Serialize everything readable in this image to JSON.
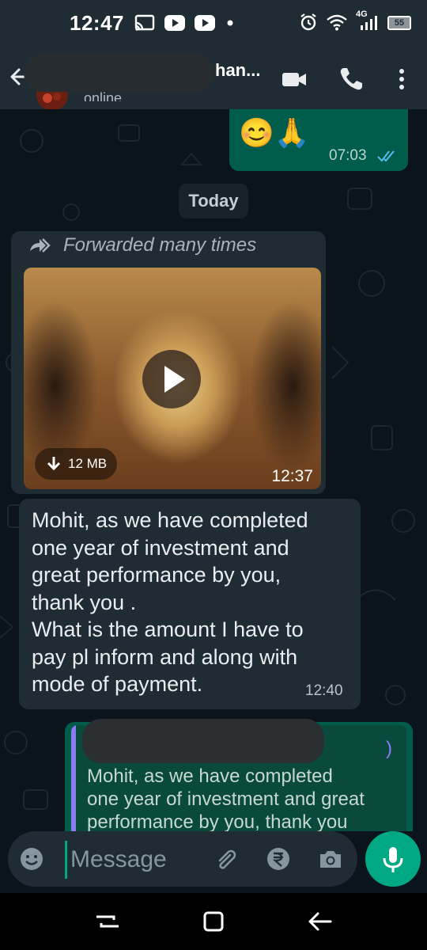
{
  "status_bar": {
    "time": "12:47",
    "network": "4G",
    "battery": "55",
    "icons": [
      "cast-icon",
      "youtube-icon",
      "youtube-icon",
      "dot-icon",
      "alarm-icon",
      "wifi-icon",
      "signal-icon",
      "battery-icon"
    ]
  },
  "header": {
    "contact_name_visible": "han...",
    "contact_status": "online",
    "icons": [
      "back-arrow-icon",
      "video-call-icon",
      "phone-icon",
      "more-options-icon"
    ]
  },
  "messages": {
    "outgoing_emoji": {
      "emojis": "😊🙏",
      "time": "07:03",
      "status": "read"
    },
    "date_chip": "Today",
    "forwarded_video": {
      "forward_label": "Forwarded many times",
      "size": "12 MB",
      "time": "12:37"
    },
    "incoming_text": {
      "lines": [
        "Mohit, as we have completed",
        "one year of investment and",
        "great performance by you,",
        "thank you .",
        "What is the amount I have to",
        "pay pl inform and along with",
        "mode of payment."
      ],
      "time": "12:40"
    },
    "reply_quote": {
      "paren": ")",
      "lines": [
        "Mohit, as we have completed",
        "one year of investment and great",
        "performance by you, thank you"
      ]
    }
  },
  "composer": {
    "placeholder": "Message",
    "icons": [
      "emoji-icon",
      "attach-icon",
      "rupee-payment-icon",
      "camera-icon",
      "mic-icon"
    ]
  },
  "colors": {
    "outgoing": "#005c4b",
    "incoming": "#202c33",
    "accent": "#00a884",
    "read_ticks": "#53bdeb"
  }
}
